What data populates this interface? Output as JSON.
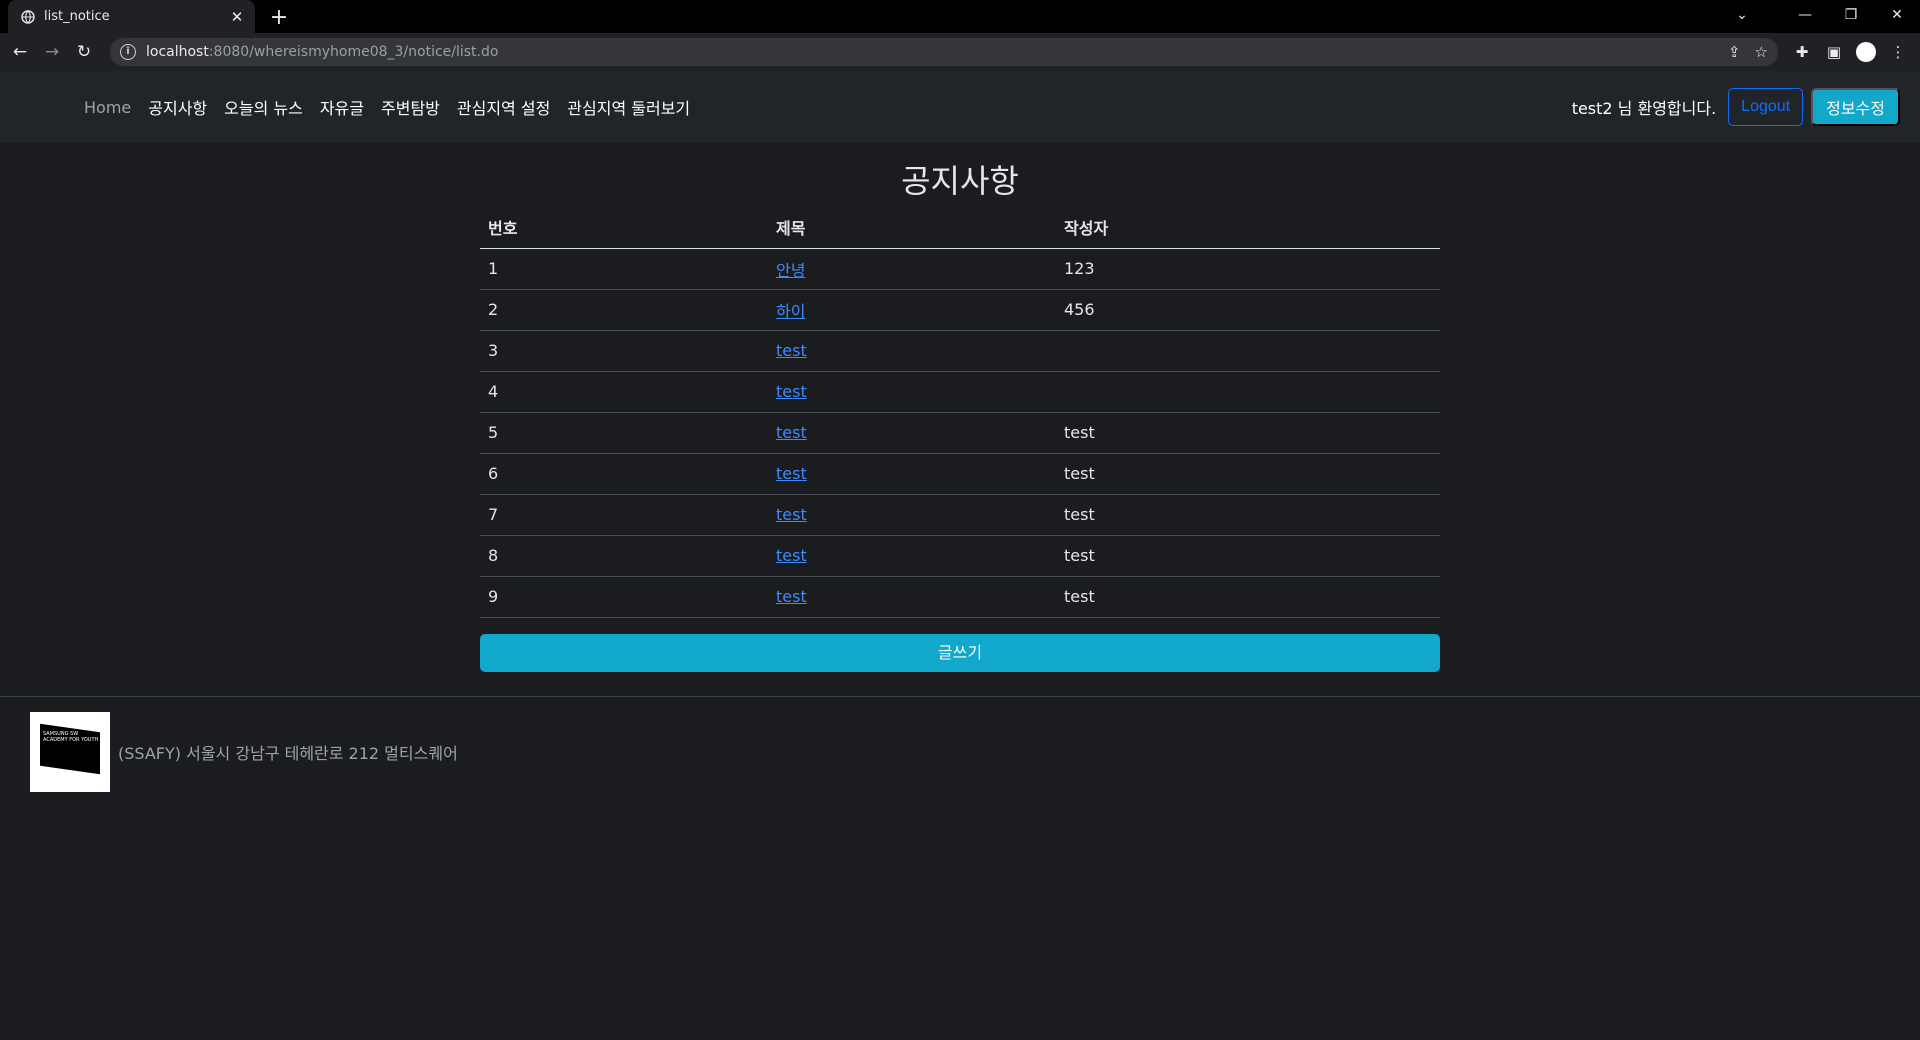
{
  "browser": {
    "tab_title": "list_notice",
    "url_host": "localhost",
    "url_path": ":8080/whereismyhome08_3/notice/list.do"
  },
  "navbar": {
    "links": [
      "Home",
      "공지사항",
      "오늘의 뉴스",
      "자유글",
      "주변탐방",
      "관심지역 설정",
      "관심지역 둘러보기"
    ],
    "welcome": "test2 님 환영합니다.",
    "logout_label": "Logout",
    "edit_label": "정보수정"
  },
  "main": {
    "title": "공지사항",
    "columns": [
      "번호",
      "제목",
      "작성자"
    ],
    "rows": [
      {
        "no": "1",
        "title": "안녕",
        "author": "123"
      },
      {
        "no": "2",
        "title": "하이",
        "author": "456"
      },
      {
        "no": "3",
        "title": "test",
        "author": ""
      },
      {
        "no": "4",
        "title": "test",
        "author": ""
      },
      {
        "no": "5",
        "title": "test",
        "author": "test"
      },
      {
        "no": "6",
        "title": "test",
        "author": "test"
      },
      {
        "no": "7",
        "title": "test",
        "author": "test"
      },
      {
        "no": "8",
        "title": "test",
        "author": "test"
      },
      {
        "no": "9",
        "title": "test",
        "author": "test"
      }
    ],
    "write_label": "글쓰기"
  },
  "footer": {
    "logo_text": "SAMSUNG SW ACADEMY FOR YOUTH",
    "address": "(SSAFY) 서울시 강남구 테헤란로 212 멀티스퀘어"
  },
  "colors": {
    "background": "#1b1c1f",
    "navbar": "#212529",
    "accent": "#11a8cc",
    "link": "#3d8bfd"
  }
}
